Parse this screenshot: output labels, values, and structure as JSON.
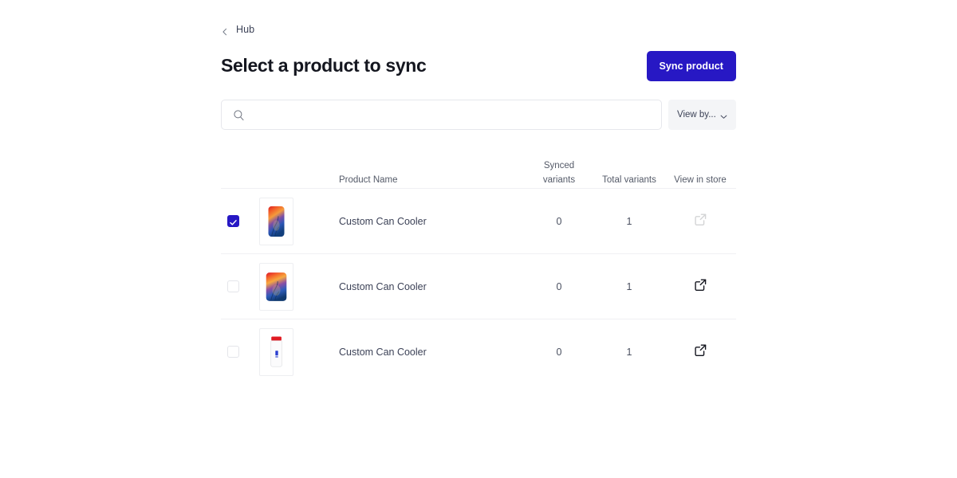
{
  "breadcrumb": {
    "icon": "chevron-left-icon",
    "label": "Hub"
  },
  "header": {
    "title": "Select a product to sync",
    "sync_button_label": "Sync product",
    "accent_color": "#2718c4"
  },
  "search": {
    "icon": "search-icon",
    "value": "",
    "placeholder": ""
  },
  "view_by": {
    "label": "View by...",
    "icon": "chevron-down-icon"
  },
  "table": {
    "columns": {
      "product_name": "Product Name",
      "synced_variants": "Synced\nvariants",
      "total_variants": "Total variants",
      "view_in_store": "View in store"
    },
    "rows": [
      {
        "selected": true,
        "thumbnail": "colorful-can-cooler-thumbnail",
        "name": "Custom Can Cooler",
        "synced_variants": "0",
        "total_variants": "1",
        "view_in_store_icon": "external-link-icon",
        "view_in_store_enabled": false
      },
      {
        "selected": false,
        "thumbnail": "colorful-can-cooler-thumbnail",
        "name": "Custom Can Cooler",
        "synced_variants": "0",
        "total_variants": "1",
        "view_in_store_icon": "external-link-icon",
        "view_in_store_enabled": true
      },
      {
        "selected": false,
        "thumbnail": "white-bottle-red-cap-thumbnail",
        "name": "Custom Can Cooler",
        "synced_variants": "0",
        "total_variants": "1",
        "view_in_store_icon": "external-link-icon",
        "view_in_store_enabled": true
      }
    ]
  }
}
